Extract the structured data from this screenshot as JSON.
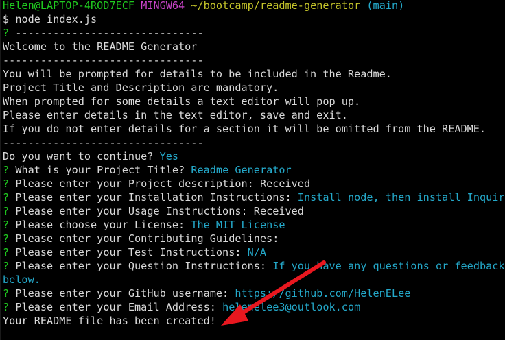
{
  "prompt": {
    "user_host": "Helen@LAPTOP-4ROD7ECF",
    "shell": "MINGW64",
    "path": "~/bootcamp/readme-generator",
    "branch": "(main)",
    "dollar": "$",
    "command": "node index.js"
  },
  "lines": {
    "sep1": "? ------------------------------",
    "welcome": "Welcome to the README Generator",
    "sep2": "--------------------------------",
    "info1": "You will be prompted for details to be included in the Readme.",
    "info2": "Project Title and Description are mandatory.",
    "info3": "When prompted for some details a text editor will pop up.",
    "info4": "Please enter details in the text editor, save and exit.",
    "info5": "If you do not enter details for a section it will be omitted from the README.",
    "sep3": "--------------------------------"
  },
  "qmark": "?",
  "continue": {
    "question": "Do you want to continue?",
    "answer": "Yes"
  },
  "questions": [
    {
      "q": "What is your Project Title?",
      "a": "Readme Generator",
      "a_color": "cyan"
    },
    {
      "q": "Please enter your Project description:",
      "a": "Received",
      "a_color": "white"
    },
    {
      "q": "Please enter your Installation Instructions:",
      "a": "Install node, then install Inquirer",
      "a_color": "cyan"
    },
    {
      "q": "Please enter your Usage Instructions:",
      "a": "Received",
      "a_color": "white"
    },
    {
      "q": "Please choose your License:",
      "a": "The MIT License",
      "a_color": "cyan"
    },
    {
      "q": "Please enter your Contributing Guidelines:",
      "a": "",
      "a_color": "white"
    },
    {
      "q": "Please enter your Test Instructions:",
      "a": "N/A",
      "a_color": "cyan"
    },
    {
      "q": "Please enter your Question Instructions:",
      "a": "If you have any questions or feedback p",
      "a_color": "cyan"
    }
  ],
  "wrap_continuation": "below.",
  "github": {
    "q": "Please enter your GitHub username:",
    "a": "https://github.com/HelenELee"
  },
  "email": {
    "q": "Please enter your Email Address:",
    "a": "helenelee3@outlook.com"
  },
  "done": "Your README file has been created!",
  "colors": {
    "background": "#000000",
    "text": "#d9d9d9",
    "green": "#1fc91f",
    "magenta": "#c944c9",
    "yellow": "#c4c42a",
    "cyan": "#24a8c9",
    "arrow": "#e8171f"
  },
  "annotation": {
    "icon": "red-arrow-icon"
  }
}
